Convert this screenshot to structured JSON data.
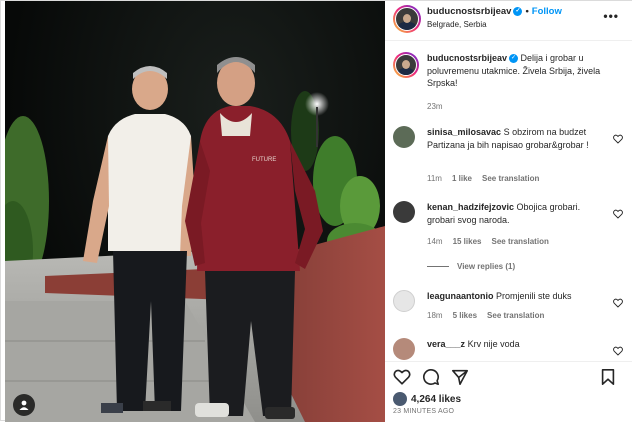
{
  "post": {
    "username": "buducnostsrbijeav",
    "follow_label": "Follow",
    "location": "Belgrade, Serbia",
    "more_label": "•••",
    "caption": "Delija i grobar u poluvremenu utakmice. Živela Srbija, živela Srpska!",
    "caption_time": "23m",
    "likes": "4,264 likes",
    "posted_ago": "23 MINUTES AGO",
    "shirt_text": "FUTURE"
  },
  "comments": [
    {
      "username": "sinisa_milosavac",
      "text": "S obzirom na budzet Partizana ja bih napisao grobar&grobar !",
      "time": "11m",
      "likes": "1 like",
      "see_translation": "See translation"
    },
    {
      "username": "kenan_hadzifejzovic",
      "text": "Obojica grobari. grobari svog naroda.",
      "time": "14m",
      "likes": "15 likes",
      "see_translation": "See translation",
      "view_replies": "View replies (1)"
    },
    {
      "username": "leagunaantonio",
      "text": "Promjenili ste duks",
      "time": "18m",
      "likes": "5 likes",
      "see_translation": "See translation"
    },
    {
      "username": "vera___z",
      "text": "Krv nije voda"
    }
  ],
  "colors": {
    "accent": "#0095f6",
    "muted": "#737373",
    "text": "#262626"
  },
  "icons": {
    "like": "heart-icon",
    "comment": "comment-icon",
    "share": "send-icon",
    "save": "bookmark-icon",
    "tag": "user-tag-icon"
  }
}
